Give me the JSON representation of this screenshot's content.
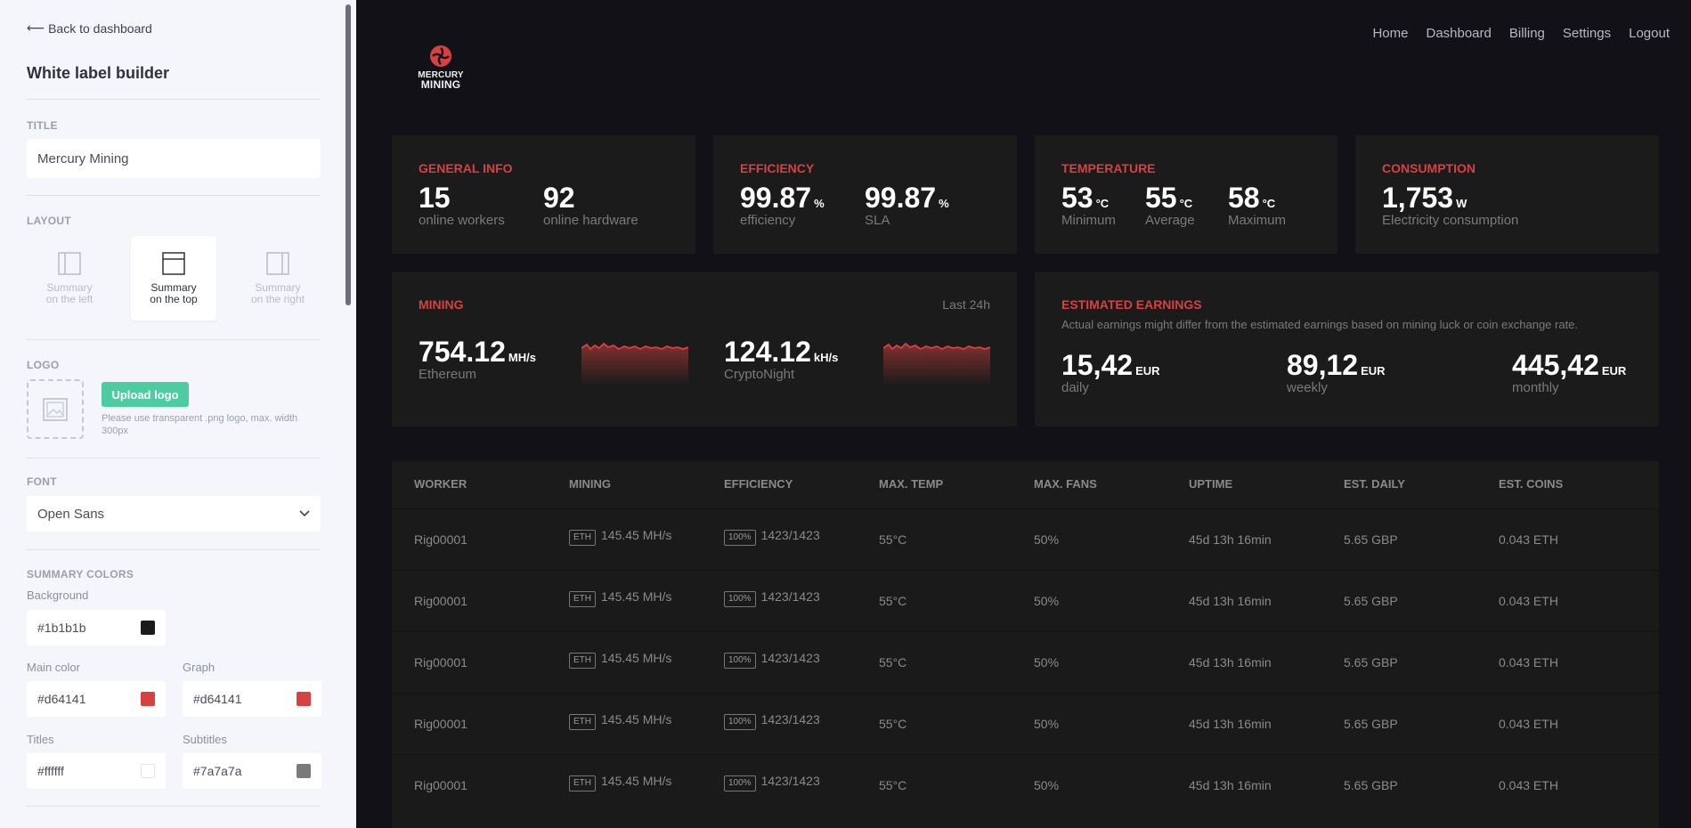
{
  "sidebar": {
    "back_label": "Back to dashboard",
    "title": "White label builder",
    "title_section": {
      "label": "TITLE",
      "value": "Mercury Mining"
    },
    "layout_section": {
      "label": "LAYOUT",
      "options": [
        {
          "line1": "Summary",
          "line2": "on the left",
          "active": false
        },
        {
          "line1": "Summary",
          "line2": "on the top",
          "active": true
        },
        {
          "line1": "Summary",
          "line2": "on the right",
          "active": false
        }
      ]
    },
    "logo_section": {
      "label": "LOGO",
      "upload_label": "Upload logo",
      "hint": "Please use transparent .png logo, max. width 300px"
    },
    "font_section": {
      "label": "FONT",
      "value": "Open Sans"
    },
    "summary_colors": {
      "label": "SUMMARY COLORS",
      "background": {
        "label": "Background",
        "value": "#1b1b1b",
        "color": "#1b1b1b"
      },
      "main_color": {
        "label": "Main color",
        "value": "#d64141",
        "color": "#d64141"
      },
      "graph": {
        "label": "Graph",
        "value": "#d64141",
        "color": "#d64141"
      },
      "titles": {
        "label": "Titles",
        "value": "#ffffff",
        "color": "#ffffff"
      },
      "subtitles": {
        "label": "Subtitles",
        "value": "#7a7a7a",
        "color": "#7a7a7a"
      }
    }
  },
  "brand": {
    "line1": "MERCURY",
    "line2": "MINING",
    "accent": "#d64141"
  },
  "nav": [
    "Home",
    "Dashboard",
    "Billing",
    "Settings",
    "Logout"
  ],
  "cards": {
    "general_info": {
      "title": "GENERAL INFO",
      "stats": [
        {
          "value": "15",
          "unit": "",
          "caption": "online workers"
        },
        {
          "value": "92",
          "unit": "",
          "caption": "online hardware"
        }
      ]
    },
    "efficiency": {
      "title": "EFFICIENCY",
      "stats": [
        {
          "value": "99.87",
          "unit": "%",
          "caption": "efficiency"
        },
        {
          "value": "99.87",
          "unit": "%",
          "caption": "SLA"
        }
      ]
    },
    "temperature": {
      "title": "TEMPERATURE",
      "stats": [
        {
          "value": "53",
          "unit": "°C",
          "caption": "Minimum"
        },
        {
          "value": "55",
          "unit": "°C",
          "caption": "Average"
        },
        {
          "value": "58",
          "unit": "°C",
          "caption": "Maximum"
        }
      ]
    },
    "consumption": {
      "title": "CONSUMPTION",
      "stats": [
        {
          "value": "1,753",
          "unit": "W",
          "caption": "Electricity consumption"
        }
      ]
    },
    "mining": {
      "title": "MINING",
      "period": "Last 24h",
      "stats": [
        {
          "value": "754.12",
          "unit": "MH/s",
          "caption": "Ethereum"
        },
        {
          "value": "124.12",
          "unit": "kH/s",
          "caption": "CryptoNight"
        }
      ]
    },
    "earnings": {
      "title": "ESTIMATED EARNINGS",
      "note": "Actual earnings might differ from the estimated earnings based on mining luck or coin exchange rate.",
      "stats": [
        {
          "value": "15,42",
          "unit": "EUR",
          "caption": "daily"
        },
        {
          "value": "89,12",
          "unit": "EUR",
          "caption": "weekly"
        },
        {
          "value": "445,42",
          "unit": "EUR",
          "caption": "monthly"
        }
      ]
    }
  },
  "table": {
    "columns": [
      "WORKER",
      "MINING",
      "EFFICIENCY",
      "MAX. TEMP",
      "MAX. FANS",
      "UPTIME",
      "EST. DAILY",
      "EST. COINS"
    ],
    "rows": [
      {
        "worker": "Rig00001",
        "coin": "ETH",
        "hashrate": "145.45 MH/s",
        "eff_tag": "100%",
        "eff": "1423/1423",
        "temp": "55°C",
        "fans": "50%",
        "uptime": "45d 13h 16min",
        "daily": "5.65 GBP",
        "coins": "0.043 ETH"
      },
      {
        "worker": "Rig00001",
        "coin": "ETH",
        "hashrate": "145.45 MH/s",
        "eff_tag": "100%",
        "eff": "1423/1423",
        "temp": "55°C",
        "fans": "50%",
        "uptime": "45d 13h 16min",
        "daily": "5.65 GBP",
        "coins": "0.043 ETH"
      },
      {
        "worker": "Rig00001",
        "coin": "ETH",
        "hashrate": "145.45 MH/s",
        "eff_tag": "100%",
        "eff": "1423/1423",
        "temp": "55°C",
        "fans": "50%",
        "uptime": "45d 13h 16min",
        "daily": "5.65 GBP",
        "coins": "0.043 ETH"
      },
      {
        "worker": "Rig00001",
        "coin": "ETH",
        "hashrate": "145.45 MH/s",
        "eff_tag": "100%",
        "eff": "1423/1423",
        "temp": "55°C",
        "fans": "50%",
        "uptime": "45d 13h 16min",
        "daily": "5.65 GBP",
        "coins": "0.043 ETH"
      },
      {
        "worker": "Rig00001",
        "coin": "ETH",
        "hashrate": "145.45 MH/s",
        "eff_tag": "100%",
        "eff": "1423/1423",
        "temp": "55°C",
        "fans": "50%",
        "uptime": "45d 13h 16min",
        "daily": "5.65 GBP",
        "coins": "0.043 ETH"
      }
    ]
  }
}
